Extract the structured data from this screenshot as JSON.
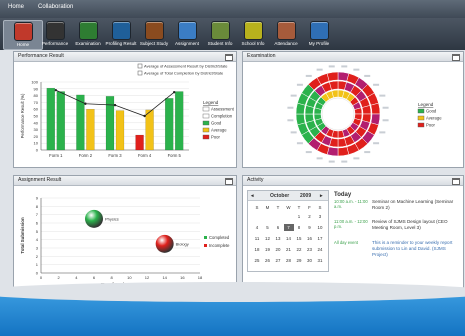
{
  "menu": {
    "home": "Home",
    "collaboration": "Collaboration"
  },
  "toolbar": [
    {
      "label": "Home",
      "icon": "house-icon",
      "color": "#c0392b",
      "active": true
    },
    {
      "label": "Performance",
      "icon": "gauge-icon",
      "color": "#333333"
    },
    {
      "label": "Examination",
      "icon": "chalkboard-icon",
      "color": "#2e7d32"
    },
    {
      "label": "Profiling Result",
      "icon": "users-icon",
      "color": "#1f5f99"
    },
    {
      "label": "Subject Study",
      "icon": "book-icon",
      "color": "#8a4b1f"
    },
    {
      "label": "Assignment",
      "icon": "pencil-paper-icon",
      "color": "#3b7dc4"
    },
    {
      "label": "Student Info",
      "icon": "student-card-icon",
      "color": "#6a8b3a"
    },
    {
      "label": "School Info",
      "icon": "school-board-icon",
      "color": "#b8b21d"
    },
    {
      "label": "Attendance",
      "icon": "calendar-icon",
      "color": "#a65b3b"
    },
    {
      "label": "My Profile",
      "icon": "person-icon",
      "color": "#2f6fb5"
    }
  ],
  "performance": {
    "title": "Performance Result",
    "legend_top": [
      "Average of Assessment Result by District/State",
      "Average of Total Completion by District/State"
    ],
    "legend_title": "Legend",
    "legend_items": [
      {
        "label": "Assessment",
        "color": "#ffffff"
      },
      {
        "label": "Completion",
        "color": "#ffffff"
      },
      {
        "label": "Good",
        "color": "#2bb24c"
      },
      {
        "label": "Average",
        "color": "#f2c218"
      },
      {
        "label": "Poor",
        "color": "#e0201c"
      }
    ],
    "chart_data": {
      "type": "bar",
      "ylabel": "Performance Result (%)",
      "ylim": [
        0,
        100
      ],
      "yticks": [
        0,
        10,
        20,
        30,
        40,
        50,
        60,
        70,
        80,
        90,
        100
      ],
      "categories": [
        "Form 1",
        "Form 2",
        "Form 3",
        "Form 4",
        "Form 5"
      ],
      "series": [
        {
          "values": [
            91,
            81,
            79,
            22,
            76
          ],
          "colors": [
            "#2bb24c",
            "#2bb24c",
            "#2bb24c",
            "#e0201c",
            "#2bb24c"
          ]
        },
        {
          "values": [
            86,
            60,
            58,
            59,
            86
          ],
          "colors": [
            "#2bb24c",
            "#f2c218",
            "#f2c218",
            "#f2c218",
            "#2bb24c"
          ]
        }
      ],
      "line_values": [
        88,
        68,
        66,
        50,
        85
      ],
      "line_colors": [
        "#222222",
        "#888888"
      ]
    }
  },
  "examination": {
    "title": "Examination",
    "legend_title": "Legend",
    "legend_items": [
      {
        "label": "Good",
        "color": "#2bb24c"
      },
      {
        "label": "Average",
        "color": "#f2c218"
      },
      {
        "label": "Poor",
        "color": "#e0201c"
      }
    ]
  },
  "assignment": {
    "title": "Assignment Result",
    "legend_items": [
      {
        "label": "Completed",
        "color": "#2bb24c"
      },
      {
        "label": "Incomplete",
        "color": "#e0201c"
      }
    ],
    "chart_data": {
      "type": "scatter",
      "xlabel": "No. of Assignment",
      "ylabel": "Total Submission",
      "xlim": [
        0,
        18
      ],
      "xticks": [
        0,
        2,
        4,
        6,
        8,
        10,
        12,
        14,
        16,
        18
      ],
      "ylim": [
        0,
        9
      ],
      "yticks": [
        0,
        1,
        2,
        3,
        4,
        5,
        6,
        7,
        8,
        9
      ],
      "points": [
        {
          "name": "Physics",
          "x": 6,
          "y": 6.5,
          "color": "#2bb24c"
        },
        {
          "name": "Biology",
          "x": 14,
          "y": 3.5,
          "color": "#e0201c"
        }
      ]
    }
  },
  "activity": {
    "title": "Activity",
    "calendar": {
      "month": "October",
      "year": "2009",
      "prev": "◂",
      "next": "▸",
      "dow": [
        "S",
        "M",
        "T",
        "W",
        "T",
        "F",
        "S"
      ],
      "weeks": [
        [
          "",
          "",
          "",
          "",
          "1",
          "2",
          "3"
        ],
        [
          "4",
          "5",
          "6",
          "7",
          "8",
          "9",
          "10"
        ],
        [
          "11",
          "12",
          "13",
          "14",
          "15",
          "16",
          "17"
        ],
        [
          "18",
          "19",
          "20",
          "21",
          "22",
          "23",
          "24"
        ],
        [
          "25",
          "26",
          "27",
          "28",
          "29",
          "30",
          "31"
        ]
      ],
      "selected": "7"
    },
    "today_label": "Today",
    "events": [
      {
        "time": "10:00 a.m. - 11:00 a.m.",
        "text": "Seminar on Machine Learning (Seminar Room 2)"
      },
      {
        "time": "11:00 a.m. - 12:00 p.m.",
        "text": "Review of SJMS Design layout (CEO Meeting Room, Level 3)"
      },
      {
        "time": "All day event",
        "text": "This is a reminder to your weekly report submission to Lin and David. (SJMS Project)"
      }
    ]
  }
}
